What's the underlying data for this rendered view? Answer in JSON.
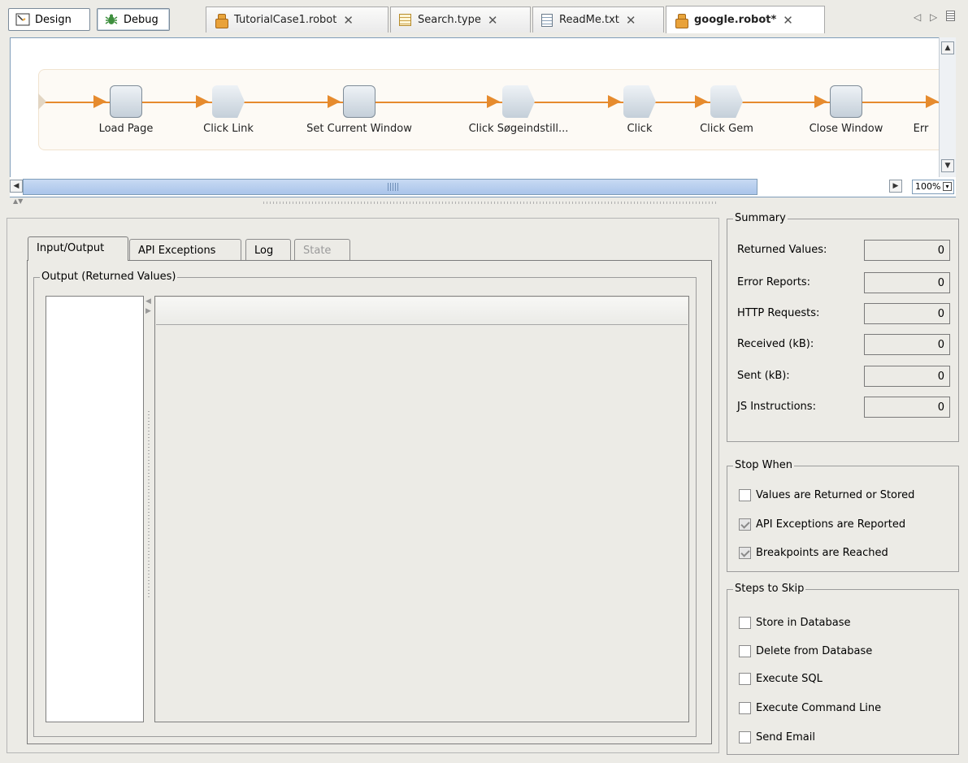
{
  "modes": [
    {
      "label": "Design",
      "icon": "design-icon"
    },
    {
      "label": "Debug",
      "icon": "bug-icon"
    }
  ],
  "tabs": [
    {
      "label": "TutorialCase1.robot",
      "icon": "robot-icon",
      "active": false
    },
    {
      "label": "Search.type",
      "icon": "type-icon",
      "active": false
    },
    {
      "label": "ReadMe.txt",
      "icon": "document-icon",
      "active": false
    },
    {
      "label": "google.robot*",
      "icon": "robot-icon",
      "active": true
    }
  ],
  "flow": {
    "steps": [
      {
        "label": "Load Page",
        "shape": "rounded"
      },
      {
        "label": "Click Link",
        "shape": "arrow"
      },
      {
        "label": "Set Current Window",
        "shape": "rounded"
      },
      {
        "label": "Click Søgeindstill...",
        "shape": "arrow"
      },
      {
        "label": "Click",
        "shape": "arrow"
      },
      {
        "label": "Click Gem",
        "shape": "arrow"
      },
      {
        "label": "Close Window",
        "shape": "rounded"
      },
      {
        "label": "Err",
        "shape": "none"
      }
    ],
    "zoom": "100%"
  },
  "panel": {
    "tabs": [
      {
        "label": "Input/Output",
        "state": "active"
      },
      {
        "label": "API Exceptions",
        "state": "normal"
      },
      {
        "label": "Log",
        "state": "normal"
      },
      {
        "label": "State",
        "state": "disabled"
      }
    ],
    "output_group_title": "Output (Returned Values)"
  },
  "summary": {
    "title": "Summary",
    "rows": [
      {
        "label": "Returned Values:",
        "value": "0"
      },
      {
        "label": "Error Reports:",
        "value": "0"
      },
      {
        "label": "HTTP Requests:",
        "value": "0"
      },
      {
        "label": "Received (kB):",
        "value": "0"
      },
      {
        "label": "Sent (kB):",
        "value": "0"
      },
      {
        "label": "JS Instructions:",
        "value": "0"
      }
    ]
  },
  "stop_when": {
    "title": "Stop When",
    "options": [
      {
        "label": "Values are Returned or Stored",
        "checked": false
      },
      {
        "label": "API Exceptions are Reported",
        "checked": true
      },
      {
        "label": "Breakpoints are Reached",
        "checked": true
      }
    ]
  },
  "steps_to_skip": {
    "title": "Steps to Skip",
    "options": [
      {
        "label": "Store in Database",
        "checked": false
      },
      {
        "label": "Delete from Database",
        "checked": false
      },
      {
        "label": "Execute SQL",
        "checked": false
      },
      {
        "label": "Execute Command Line",
        "checked": false
      },
      {
        "label": "Send Email",
        "checked": false
      }
    ]
  },
  "colors": {
    "flow_line": "#e68b2e",
    "scroll_thumb": "#a9c4ea"
  }
}
